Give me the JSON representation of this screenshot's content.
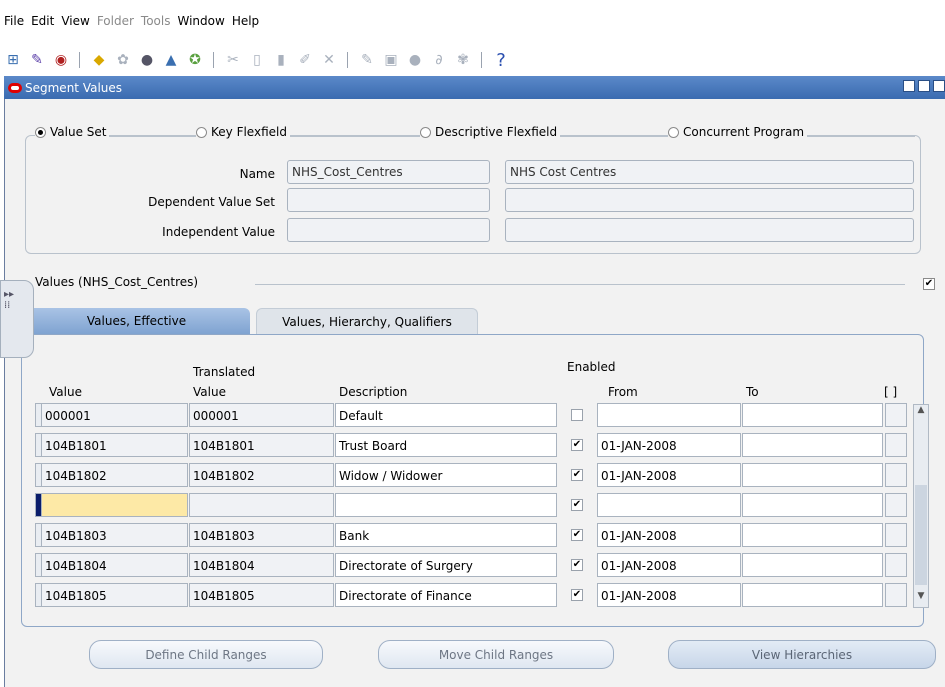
{
  "menubar": {
    "items": [
      "File",
      "Edit",
      "View",
      "Folder",
      "Tools",
      "Window",
      "Help"
    ]
  },
  "toolbar": {
    "help_glyph": "?"
  },
  "window": {
    "title": "Segment Values"
  },
  "source": {
    "options": [
      "Value Set",
      "Key Flexfield",
      "Descriptive Flexfield",
      "Concurrent Program"
    ],
    "selected": "Value Set"
  },
  "fields": {
    "name_label": "Name",
    "name_value": "NHS_Cost_Centres",
    "name_description": "NHS Cost Centres",
    "dependent_label": "Dependent Value Set",
    "independent_label": "Independent Value"
  },
  "values_section": {
    "title": "Values (NHS_Cost_Centres)",
    "checked": true
  },
  "tabs": {
    "active": "Values, Effective",
    "other": "Values, Hierarchy, Qualifiers"
  },
  "columns": {
    "value": "Value",
    "translated_top": "Translated",
    "translated_bottom": "Value",
    "description": "Description",
    "enabled": "Enabled",
    "from": "From",
    "to": "To",
    "dff": "[ ]"
  },
  "rows": [
    {
      "value": "000001",
      "translated": "000001",
      "description": "Default",
      "enabled": false,
      "from": "",
      "to": ""
    },
    {
      "value": "104B1801",
      "translated": "104B1801",
      "description": "Trust Board",
      "enabled": true,
      "from": "01-JAN-2008",
      "to": ""
    },
    {
      "value": "104B1802",
      "translated": "104B1802",
      "description": "Widow / Widower",
      "enabled": true,
      "from": "01-JAN-2008",
      "to": ""
    },
    {
      "value": "",
      "translated": "",
      "description": "",
      "enabled": true,
      "from": "",
      "to": "",
      "current": true
    },
    {
      "value": "104B1803",
      "translated": "104B1803",
      "description": "Bank",
      "enabled": true,
      "from": "01-JAN-2008",
      "to": ""
    },
    {
      "value": "104B1804",
      "translated": "104B1804",
      "description": "Directorate of Surgery",
      "enabled": true,
      "from": "01-JAN-2008",
      "to": ""
    },
    {
      "value": "104B1805",
      "translated": "104B1805",
      "description": "Directorate of Finance",
      "enabled": true,
      "from": "01-JAN-2008",
      "to": ""
    }
  ],
  "buttons": {
    "define_child_ranges": "Define Child Ranges",
    "move_child_ranges": "Move Child Ranges",
    "view_hierarchies": "View Hierarchies"
  }
}
